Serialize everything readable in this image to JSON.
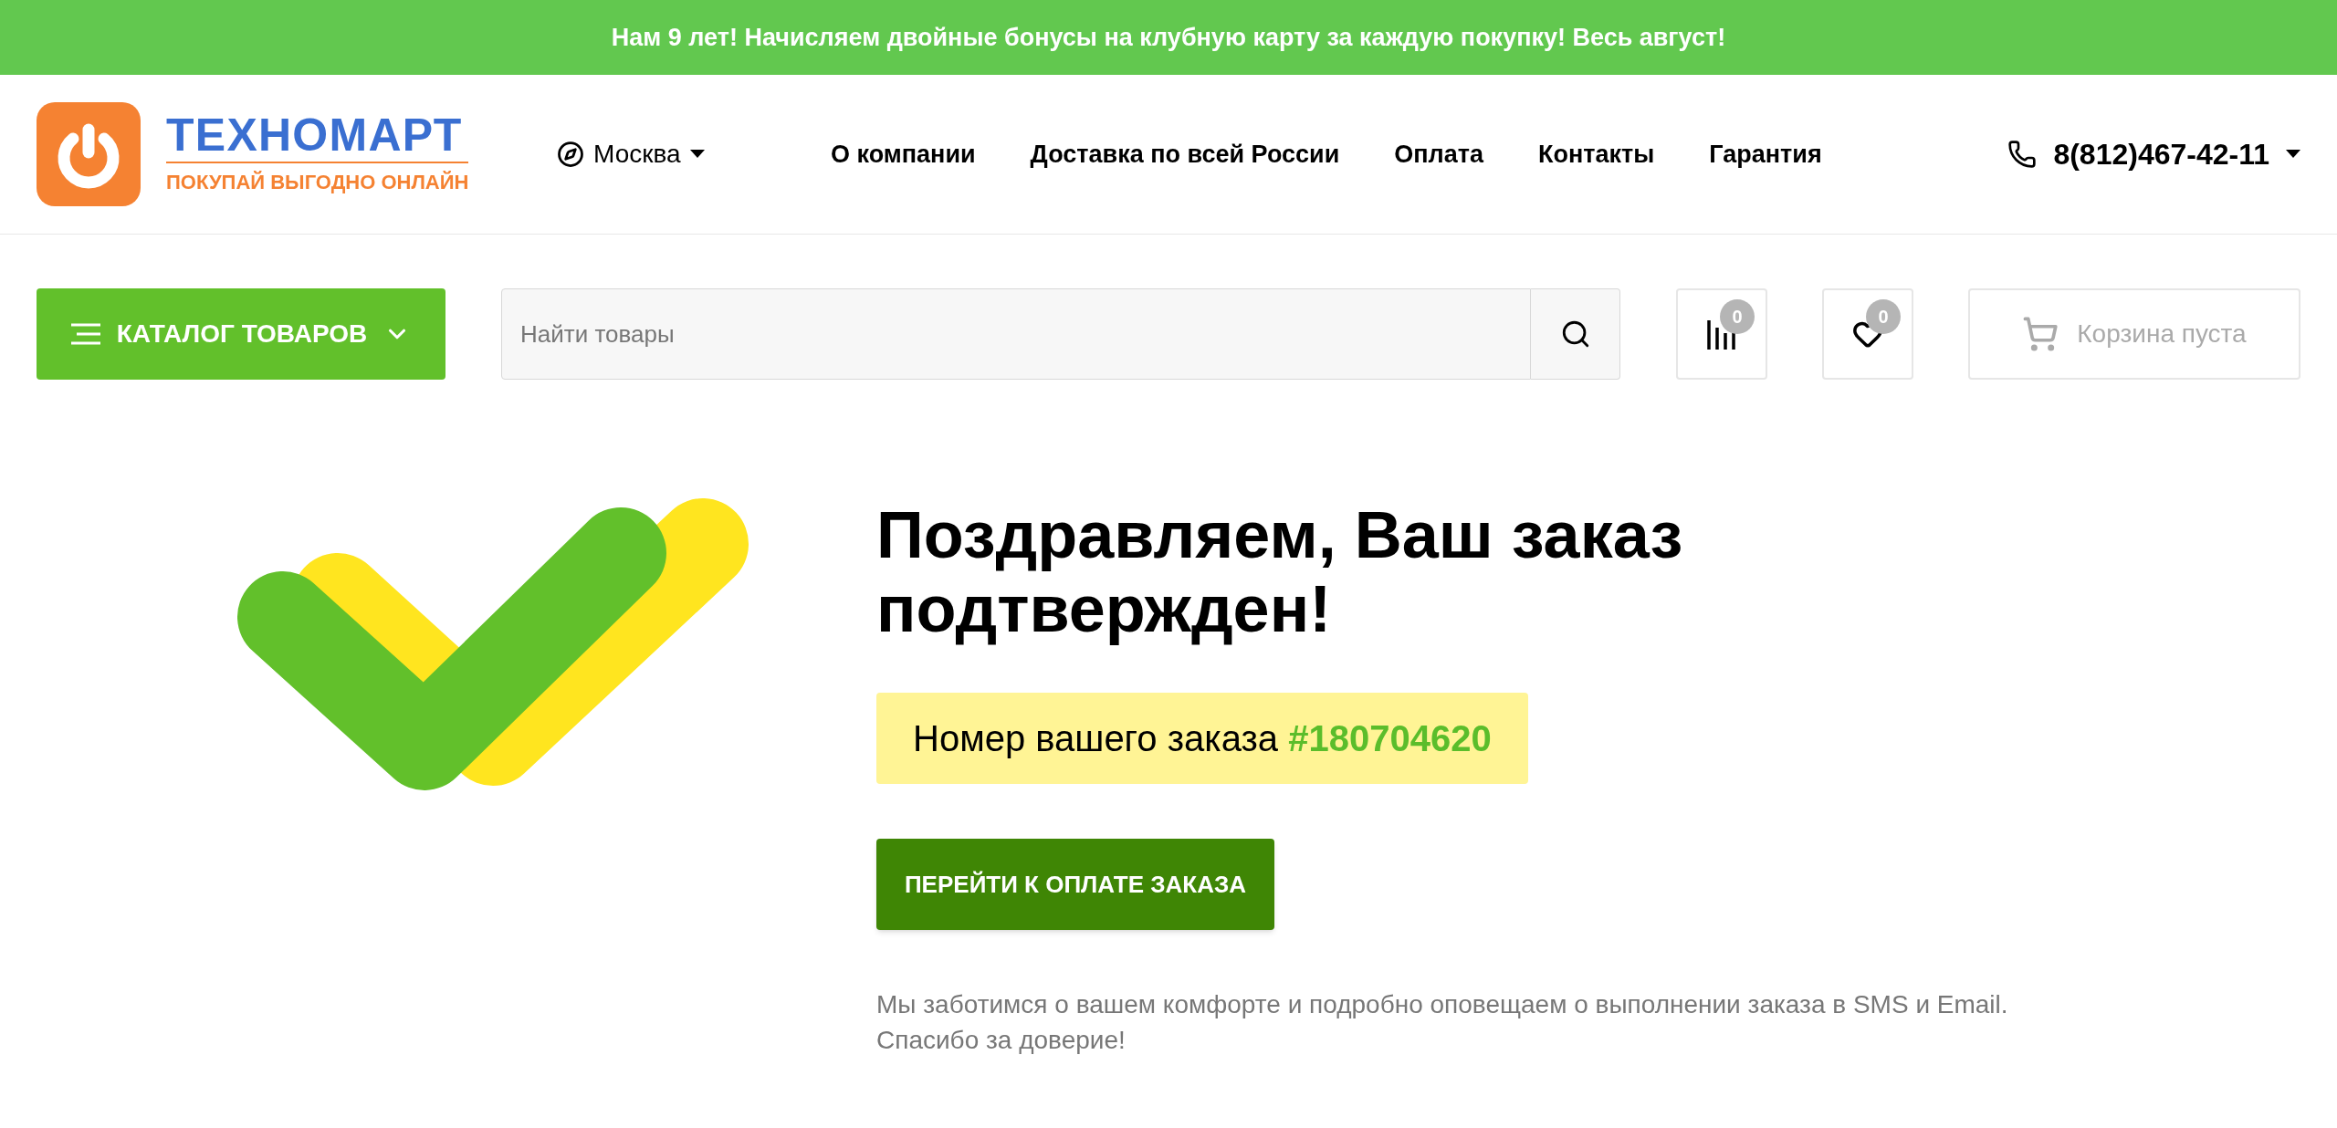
{
  "banner": {
    "text": "Нам 9 лет! Начисляем двойные бонусы на клубную карту за каждую покупку! Весь август!"
  },
  "header": {
    "logo": {
      "title": "ТЕХНОМАРТ",
      "tagline": "ПОКУПАЙ ВЫГОДНО ОНЛАЙН"
    },
    "city": "Москва",
    "nav": [
      "О компании",
      "Доставка по всей России",
      "Оплата",
      "Контакты",
      "Гарантия"
    ],
    "phone": "8(812)467-42-11"
  },
  "toolbar": {
    "catalog_button": "КАТАЛОГ ТОВАРОВ",
    "search": {
      "placeholder": "Найти товары"
    },
    "compare": {
      "count": "0"
    },
    "favorites": {
      "count": "0"
    },
    "cart": {
      "label": "Корзина пуста"
    }
  },
  "confirmation": {
    "heading": "Поздравляем, Ваш заказ подтвержден!",
    "order_label": "Номер вашего заказа",
    "order_number": "#180704620",
    "pay_button": "ПЕРЕЙТИ К ОПЛАТЕ ЗАКАЗА",
    "note_lines": [
      "Мы заботимся о вашем комфорте и подробно оповещаем о выполнении заказа в SMS и Email.",
      "Спасибо за доверие!"
    ]
  }
}
